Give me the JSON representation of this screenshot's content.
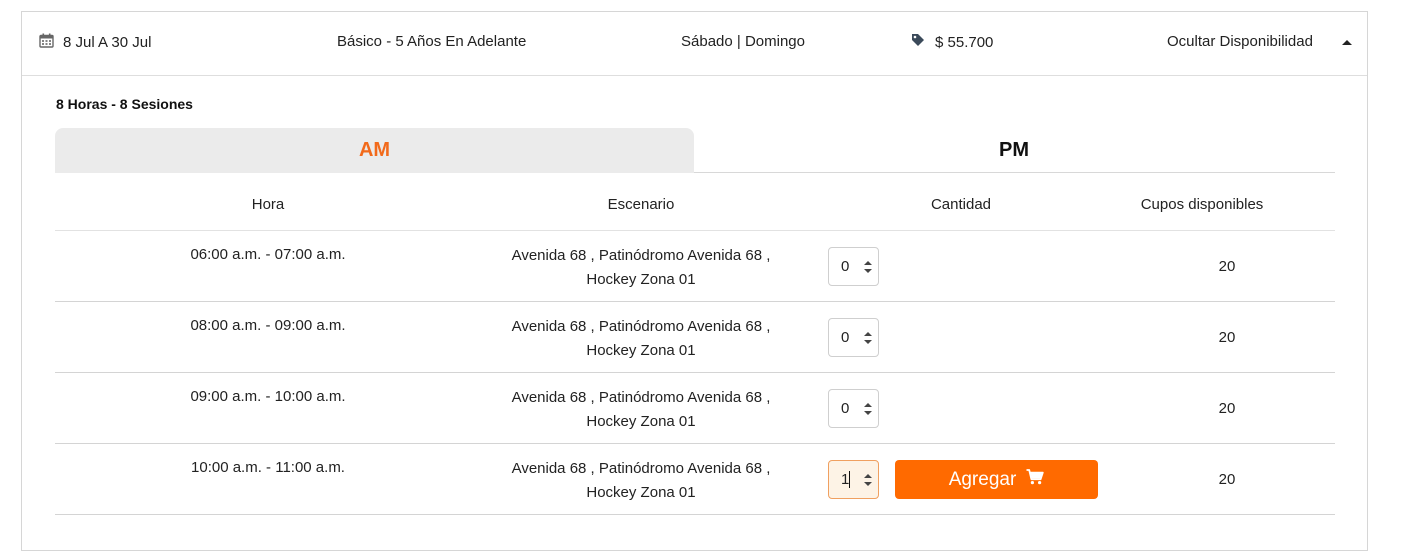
{
  "summary": {
    "dates": "8 Jul A 30 Jul",
    "level": "Básico - 5 Años En Adelante",
    "days": "Sábado | Domingo",
    "price": "$ 55.700",
    "toggle_label": "Ocultar Disponibilidad"
  },
  "sessions_label": "8 Horas - 8 Sesiones",
  "tabs": [
    {
      "label": "AM",
      "active": true
    },
    {
      "label": "PM",
      "active": false
    }
  ],
  "table": {
    "headers": [
      "Hora",
      "Escenario",
      "Cantidad",
      "Cupos disponibles"
    ],
    "rows": [
      {
        "hora": "06:00 a.m. - 07:00 a.m.",
        "escenario_line1": "Avenida 68 , Patinódromo Avenida 68 ,",
        "escenario_line2": "Hockey Zona 01",
        "cantidad": "0",
        "cupos": "20"
      },
      {
        "hora": "08:00 a.m. - 09:00 a.m.",
        "escenario_line1": "Avenida 68 , Patinódromo Avenida 68 ,",
        "escenario_line2": "Hockey Zona 01",
        "cantidad": "0",
        "cupos": "20"
      },
      {
        "hora": "09:00 a.m. - 10:00 a.m.",
        "escenario_line1": "Avenida 68 , Patinódromo Avenida 68 ,",
        "escenario_line2": "Hockey Zona 01",
        "cantidad": "0",
        "cupos": "20"
      },
      {
        "hora": "10:00 a.m. - 11:00 a.m.",
        "escenario_line1": "Avenida 68 , Patinódromo Avenida 68 ,",
        "escenario_line2": "Hockey Zona 01",
        "cantidad": "1",
        "cupos": "20"
      }
    ],
    "add_button_label": "Agregar"
  },
  "icons": {
    "dates": "calendar-icon",
    "price": "tag-icon",
    "toggle": "caret-up-icon",
    "add": "shopping-cart-icon"
  },
  "colors": {
    "accent": "#f26a1b",
    "button": "#ff6a00",
    "tab_inactive_bg": "#ebebeb"
  }
}
